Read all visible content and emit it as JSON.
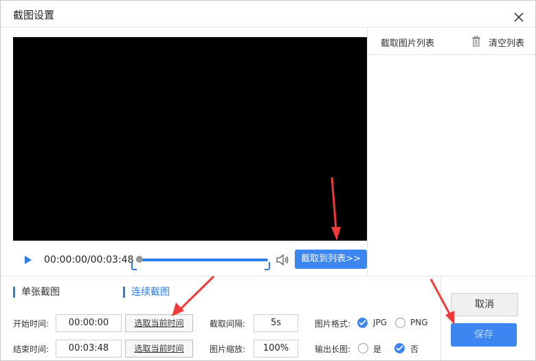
{
  "dialog": {
    "title": "截图设置"
  },
  "player": {
    "timecode": "00:00:00/00:03:48",
    "capture_to_list": "截取到列表>>"
  },
  "image_list": {
    "header": "截取图片列表",
    "clear": "清空列表"
  },
  "tabs": {
    "single": "单张截图",
    "continuous": "连续截图"
  },
  "form": {
    "start_label": "开始时间:",
    "start_value": "00:00:00",
    "end_label": "结束时间:",
    "end_value": "00:03:48",
    "pick_current": "选取当前时间",
    "interval_label": "截取间隔:",
    "interval_value": "5s",
    "scale_label": "图片缩放:",
    "scale_value": "100%",
    "format_label": "图片格式:",
    "format_jpg": "JPG",
    "format_png": "PNG",
    "long_label": "输出长图:",
    "long_yes": "是",
    "long_no": "否",
    "selected_format": "JPG",
    "selected_long": "否"
  },
  "actions": {
    "cancel": "取消",
    "save": "保存"
  },
  "colors": {
    "accent": "#3b86f0",
    "annotation_arrow": "#f03a3a"
  }
}
